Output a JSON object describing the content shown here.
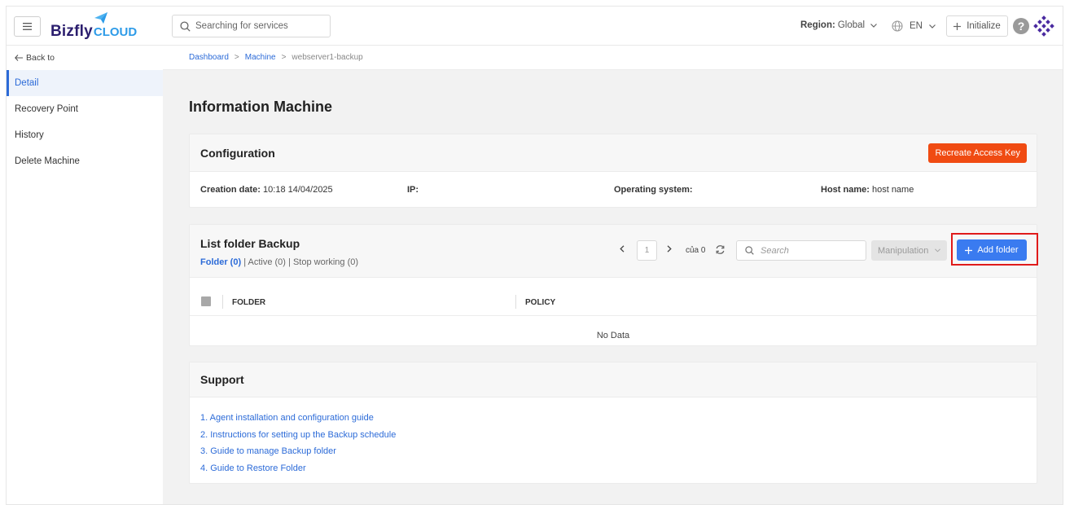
{
  "header": {
    "logo_main": "Bizfly",
    "logo_sub": "CLOUD",
    "search_placeholder": "Searching for services",
    "region_label": "Region:",
    "region_value": "Global",
    "language": "EN",
    "initialize_label": "Initialize"
  },
  "sidebar": {
    "back_label": "Back to",
    "items": [
      {
        "label": "Detail",
        "active": true
      },
      {
        "label": "Recovery Point",
        "active": false
      },
      {
        "label": "History",
        "active": false
      },
      {
        "label": "Delete Machine",
        "active": false
      }
    ]
  },
  "breadcrumb": [
    "Dashboard",
    "Machine",
    "webserver1-backup"
  ],
  "page_title": "Information Machine",
  "configuration": {
    "title": "Configuration",
    "recreate_label": "Recreate Access Key",
    "creation_label": "Creation date:",
    "creation_value": "10:18 14/04/2025",
    "ip_label": "IP:",
    "ip_value": "",
    "os_label": "Operating system:",
    "os_value": "",
    "host_label": "Host name:",
    "host_value": "host name"
  },
  "folders": {
    "title": "List folder Backup",
    "filter_folder": "Folder (0)",
    "filter_active": "Active (0)",
    "filter_stop": "Stop working (0)",
    "page": "1",
    "total": "của 0",
    "search_placeholder": "Search",
    "manipulation_label": "Manipulation",
    "add_label": "Add folder",
    "col_folder": "FOLDER",
    "col_policy": "POLICY",
    "no_data": "No Data"
  },
  "support": {
    "title": "Support",
    "links": [
      "1. Agent installation and configuration guide",
      "2. Instructions for setting up the Backup schedule",
      "3. Guide to manage Backup folder",
      "4. Guide to Restore Folder"
    ]
  },
  "colors": {
    "accent": "#2c6bd8",
    "danger": "#f04b12",
    "primary_button": "#3a7bf0",
    "highlight": "#e01b1b"
  }
}
